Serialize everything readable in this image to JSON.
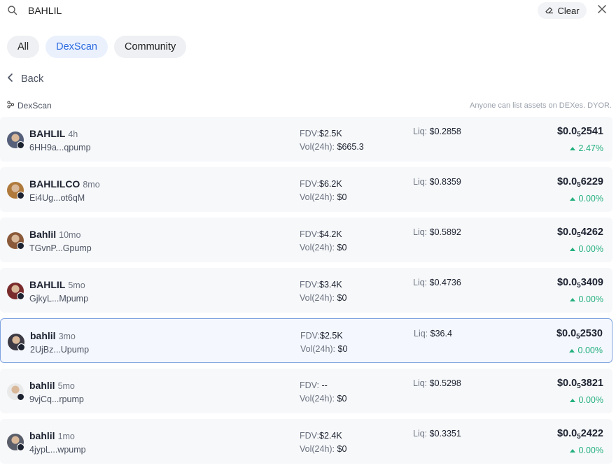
{
  "search": {
    "value": "BAHLIL",
    "clear_label": "Clear"
  },
  "tabs": [
    {
      "label": "All",
      "active": false
    },
    {
      "label": "DexScan",
      "active": true
    },
    {
      "label": "Community",
      "active": false
    }
  ],
  "back_label": "Back",
  "section": {
    "label": "DexScan",
    "disclaimer": "Anyone can list assets on DEXes. DYOR."
  },
  "colors": {
    "accent": "#2d6be0",
    "positive": "#22b07d",
    "highlight_border": "#7ea3e0"
  },
  "results": [
    {
      "name": "BAHLIL",
      "age": "4h",
      "address": "6HH9a...qpump",
      "fdv": "$2.5K",
      "vol": "$665.3",
      "liq": "$0.2858",
      "price_prefix": "$0.0",
      "price_zeros": "5",
      "price_digits": "2541",
      "change": "2.47%",
      "avatar_color": "#56607a",
      "highlighted": false
    },
    {
      "name": "BAHLILCO",
      "age": "8mo",
      "address": "Ei4Ug...ot6qM",
      "fdv": "$6.2K",
      "vol": "$0",
      "liq": "$0.8359",
      "price_prefix": "$0.0",
      "price_zeros": "5",
      "price_digits": "6229",
      "change": "0.00%",
      "avatar_color": "#b07a3c",
      "highlighted": false
    },
    {
      "name": "Bahlil",
      "age": "10mo",
      "address": "TGvnP...Gpump",
      "fdv": "$4.2K",
      "vol": "$0",
      "liq": "$0.5892",
      "price_prefix": "$0.0",
      "price_zeros": "5",
      "price_digits": "4262",
      "change": "0.00%",
      "avatar_color": "#8a5a3a",
      "highlighted": false
    },
    {
      "name": "BAHLIL",
      "age": "5mo",
      "address": "GjkyL...Mpump",
      "fdv": "$3.4K",
      "vol": "$0",
      "liq": "$0.4736",
      "price_prefix": "$0.0",
      "price_zeros": "5",
      "price_digits": "3409",
      "change": "0.00%",
      "avatar_color": "#7a2c2c",
      "highlighted": false
    },
    {
      "name": "bahlil",
      "age": "3mo",
      "address": "2UjBz...Upump",
      "fdv": "$2.5K",
      "vol": "$0",
      "liq": "$36.4",
      "price_prefix": "$0.0",
      "price_zeros": "5",
      "price_digits": "2530",
      "change": "0.00%",
      "avatar_color": "#3c3a44",
      "highlighted": true
    },
    {
      "name": "bahlil",
      "age": "5mo",
      "address": "9vjCq...rpump",
      "fdv": "--",
      "vol": "$0",
      "liq": "$0.5298",
      "price_prefix": "$0.0",
      "price_zeros": "5",
      "price_digits": "3821",
      "change": "0.00%",
      "avatar_color": "#e9e9e9",
      "highlighted": false
    },
    {
      "name": "bahlil",
      "age": "1mo",
      "address": "4jypL...wpump",
      "fdv": "$2.4K",
      "vol": "$0",
      "liq": "$0.3351",
      "price_prefix": "$0.0",
      "price_zeros": "5",
      "price_digits": "2422",
      "change": "0.00%",
      "avatar_color": "#5a5e6a",
      "highlighted": false
    }
  ],
  "labels": {
    "fdv": "FDV:",
    "vol": "Vol(24h):",
    "liq": "Liq:"
  }
}
